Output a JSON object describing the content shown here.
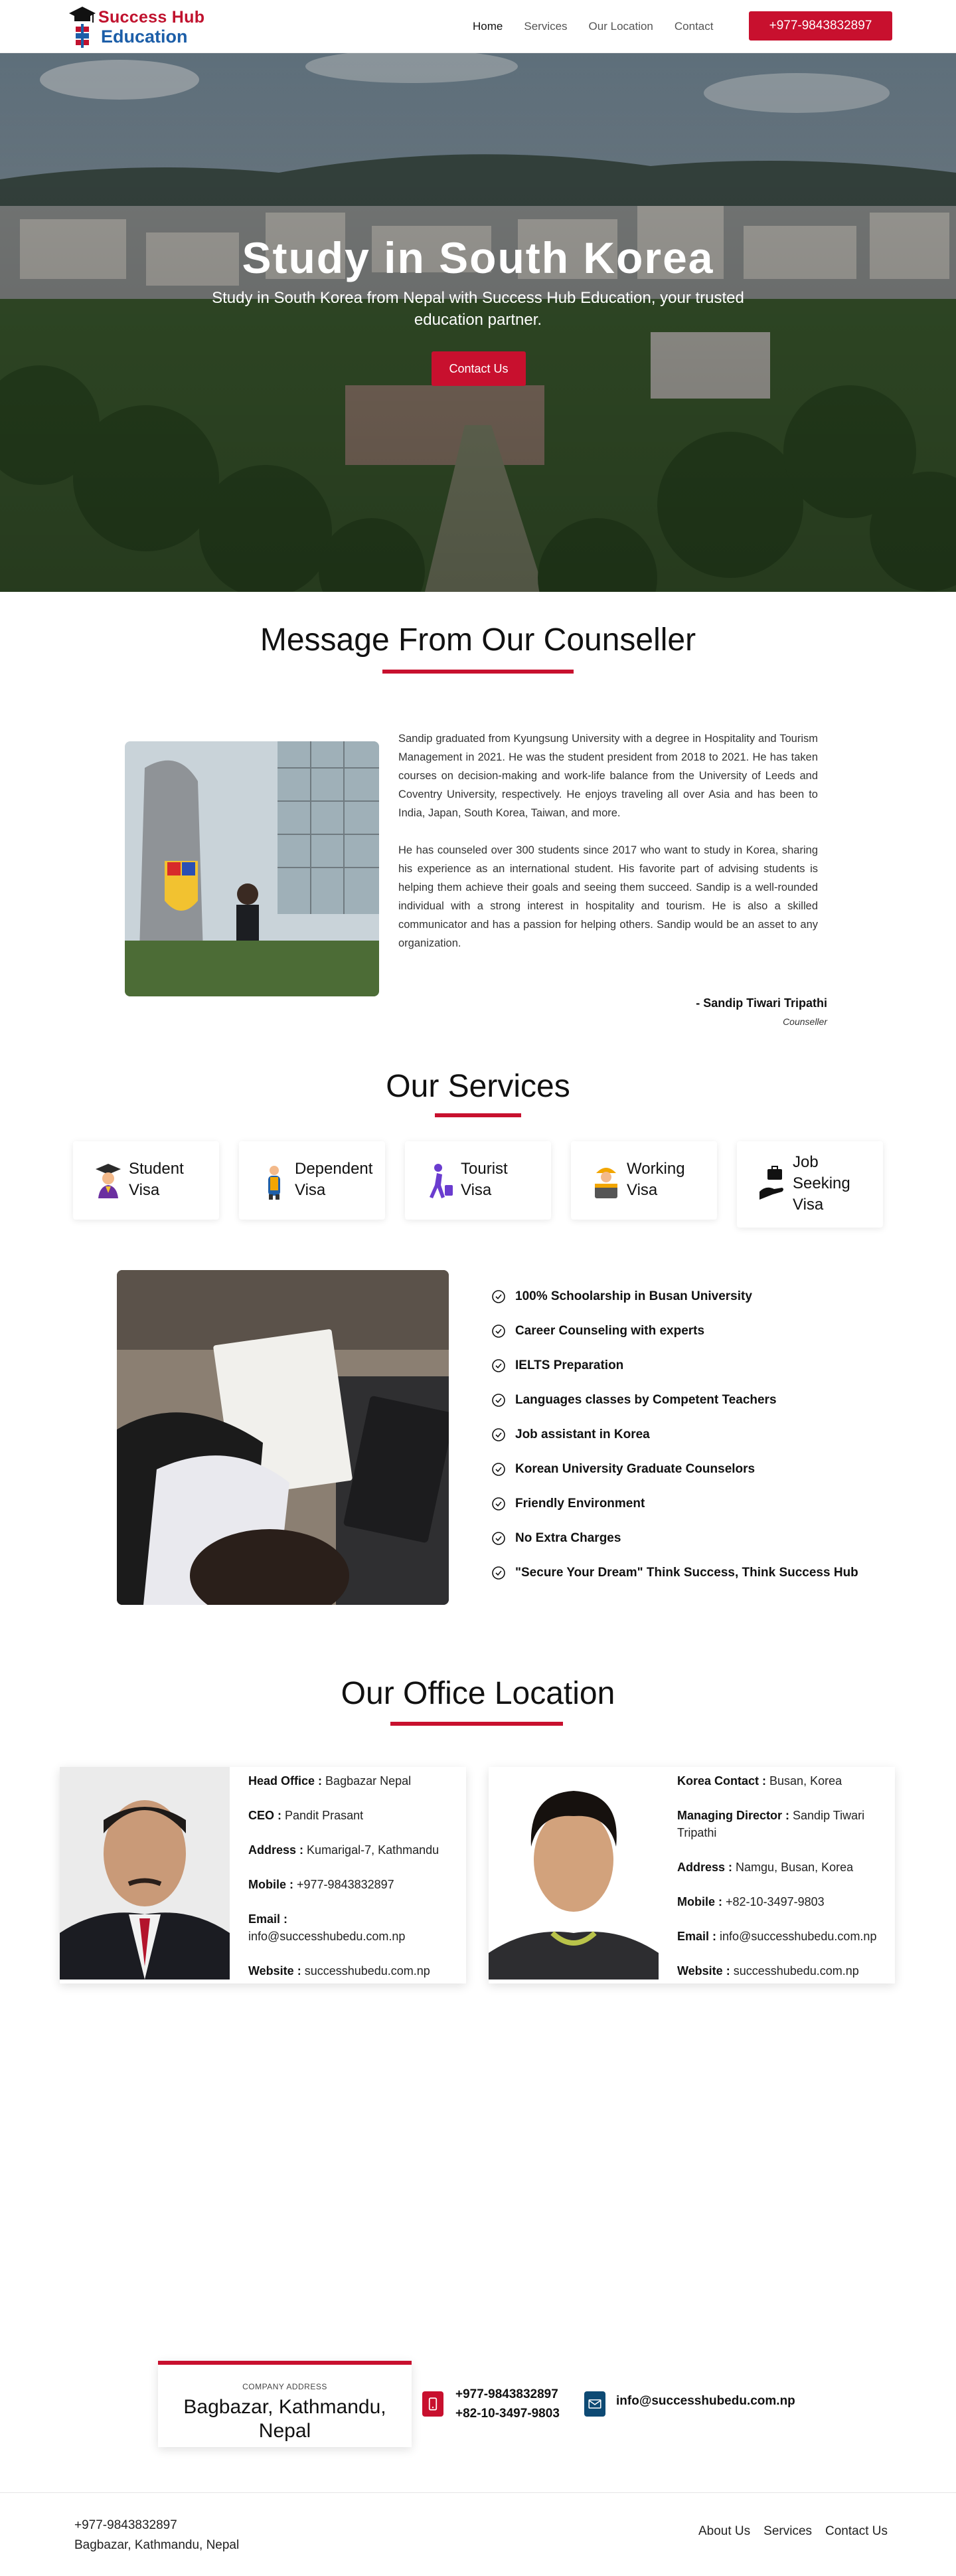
{
  "header": {
    "logo_line1": "Success Hub",
    "logo_line2": "Education",
    "nav": [
      "Home",
      "Services",
      "Our Location",
      "Contact"
    ],
    "phone_button": "+977-9843832897"
  },
  "hero": {
    "title": "Study in South Korea",
    "subtitle": "Study in South Korea from Nepal with Success Hub Education, your trusted education partner.",
    "button": "Contact Us"
  },
  "counseller": {
    "heading": "Message From Our Counseller",
    "paragraph1": "Sandip graduated from Kyungsung University with a degree in Hospitality and Tourism Management in 2021. He was the student president from 2018 to 2021. He has taken courses on decision-making and work-life balance from the University of Leeds and Coventry University, respectively. He enjoys traveling all over Asia and has been to India, Japan, South Korea, Taiwan, and more.",
    "paragraph2": "He has counseled over 300 students since 2017 who want to study in Korea, sharing his experience as an international student. His favorite part of advising students is helping them achieve their goals and seeing them succeed. Sandip is a well-rounded individual with a strong interest in hospitality and tourism. He is also a skilled communicator and has a passion for helping others. Sandip would be an asset to any organization.",
    "name": "- Sandip Tiwari Tripathi",
    "role": "Counseller"
  },
  "services": {
    "heading": "Our Services",
    "cards": [
      {
        "line1": "Student",
        "line2": "Visa",
        "icon": "graduate-icon"
      },
      {
        "line1": "Dependent",
        "line2": "Visa",
        "icon": "family-icon"
      },
      {
        "line1": "Tourist",
        "line2": "Visa",
        "icon": "traveler-icon"
      },
      {
        "line1": "Working",
        "line2": "Visa",
        "icon": "worker-icon"
      },
      {
        "line1": "Job",
        "line2": "Seeking",
        "line3": "Visa",
        "icon": "job-seeking-icon"
      }
    ],
    "features": [
      "100% Schoolarship in Busan University",
      "Career Counseling with experts",
      "IELTS Preparation",
      "Languages classes by Competent Teachers",
      "Job assistant in Korea",
      "Korean University Graduate Counselors",
      "Friendly Environment",
      "No Extra Charges",
      "\"Secure Your Dream\" Think Success, Think Success Hub"
    ]
  },
  "offices": {
    "heading": "Our Office Location",
    "head_office": {
      "label1": "Head Office :",
      "value1": "Bagbazar Nepal",
      "label2": "CEO :",
      "value2": "Pandit Prasant",
      "label3": "Address :",
      "value3": "Kumarigal-7, Kathmandu",
      "label4": "Mobile :",
      "value4": "+977-9843832897",
      "label5": "Email :",
      "value5": "info@successhubedu.com.np",
      "label6": "Website :",
      "value6": "successhubedu.com.np"
    },
    "korea_office": {
      "label1": "Korea Contact :",
      "value1": "Busan, Korea",
      "label2": "Managing Director :",
      "value2": "Sandip Tiwari Tripathi",
      "label3": "Address :",
      "value3": "Namgu, Busan, Korea",
      "label4": "Mobile :",
      "value4": "+82-10-3497-9803",
      "label5": "Email :",
      "value5": "info@successhubedu.com.np",
      "label6": "Website :",
      "value6": "successhubedu.com.np"
    }
  },
  "contact_strip": {
    "company_address_label": "COMPANY ADDRESS",
    "address_line1": "Bagbazar, Kathmandu,",
    "address_line2": "Nepal",
    "phone1": "+977-9843832897",
    "phone2": "+82-10-3497-9803",
    "email": "info@successhubedu.com.np"
  },
  "footer": {
    "phone": "+977-9843832897",
    "address": "Bagbazar, Kathmandu, Nepal",
    "links": [
      "About Us",
      "Services",
      "Contact Us"
    ]
  },
  "colors": {
    "accent": "#c8102e",
    "brand_blue": "#1c5ea8",
    "mail_icon_bg": "#0e4a74"
  }
}
